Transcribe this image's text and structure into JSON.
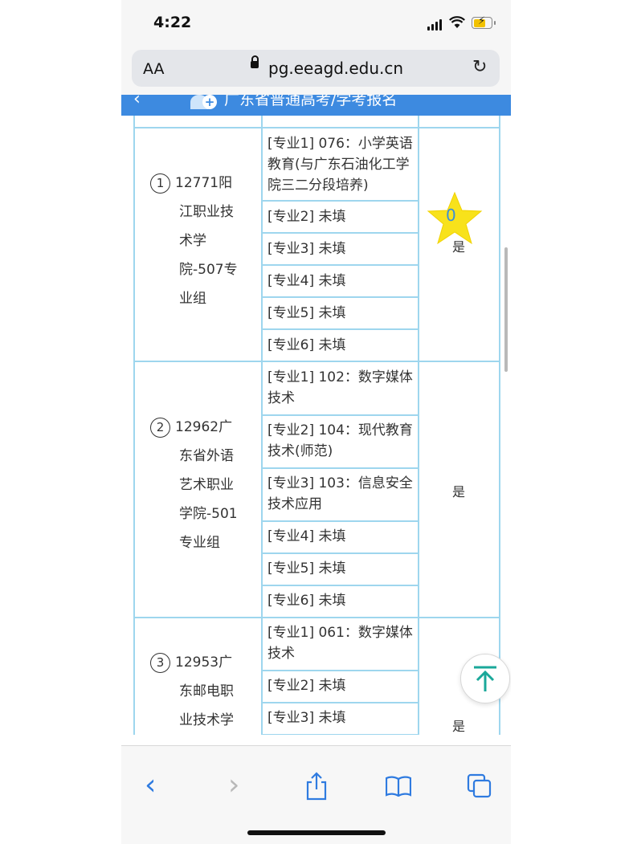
{
  "status": {
    "time": "4:22"
  },
  "browser": {
    "aa_label": "AA",
    "url": "pg.eeagd.edu.cn",
    "toolbar": {
      "back": "‹",
      "forward": "›"
    }
  },
  "page": {
    "title": "广东省普通高考/学考报名",
    "star_value": "0",
    "rows": [
      {
        "index": "1",
        "school_lines": [
          "12771阳",
          "江职业技",
          "术学",
          "院-507专",
          "业组"
        ],
        "majors": [
          "[专业1] 076：小学英语教育(与广东石油化工学院三二分段培养)",
          "[专业2] 未填",
          "[专业3] 未填",
          "[专业4] 未填",
          "[专业5] 未填",
          "[专业6] 未填"
        ],
        "obey": "是"
      },
      {
        "index": "2",
        "school_lines": [
          "12962广",
          "东省外语",
          "艺术职业",
          "学院-501",
          "专业组"
        ],
        "majors": [
          "[专业1] 102：数字媒体技术",
          "[专业2] 104：现代教育技术(师范)",
          "[专业3] 103：信息安全技术应用",
          "[专业4] 未填",
          "[专业5] 未填",
          "[专业6] 未填"
        ],
        "obey": "是"
      },
      {
        "index": "3",
        "school_lines": [
          "12953广",
          "东邮电职",
          "业技术学"
        ],
        "majors": [
          "[专业1] 061：数字媒体技术",
          "[专业2] 未填",
          "[专业3] 未填"
        ],
        "obey": "是"
      }
    ]
  }
}
